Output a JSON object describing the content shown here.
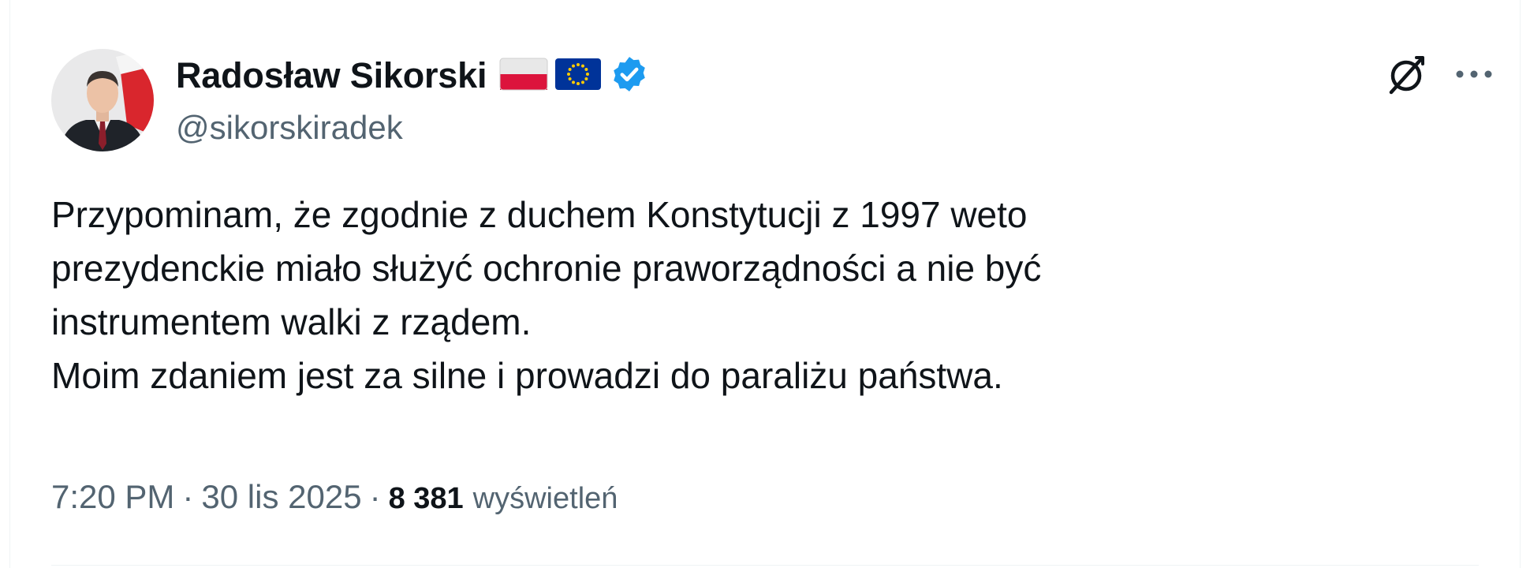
{
  "author": {
    "display_name": "Radosław Sikorski",
    "handle": "@sikorskiradek",
    "flags": [
      "poland-flag-icon",
      "eu-flag-icon"
    ],
    "verified_icon": "verified-badge-icon",
    "verified_color": "#1d9bf0"
  },
  "tweet": {
    "lines": [
      "Przypominam, że zgodnie z duchem Konstytucji z 1997 weto",
      "prezydenckie miało służyć ochronie praworządności a nie być",
      "instrumentem walki z rządem.",
      "Moim zdaniem jest za silne i prowadzi do paraliżu państwa."
    ]
  },
  "meta": {
    "time": "7:20 PM",
    "separator": "·",
    "date": "30 lis 2025",
    "views_count": "8 381",
    "views_label": "wyświetleń"
  },
  "actions": {
    "grok_icon": "grok-icon",
    "more_icon": "more-options-icon"
  },
  "colors": {
    "text": "#0f1419",
    "secondary": "#536471",
    "accent": "#1d9bf0"
  }
}
